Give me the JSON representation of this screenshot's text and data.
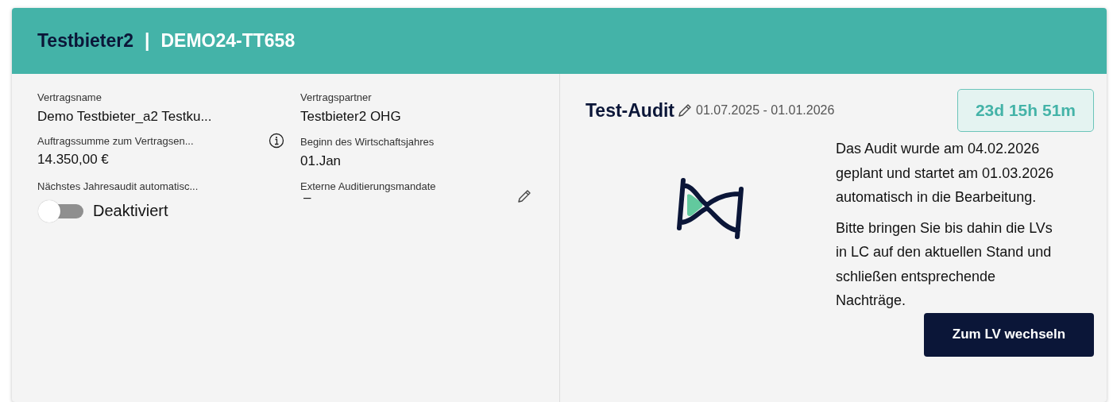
{
  "header": {
    "bidder": "Testbieter2",
    "separator": "|",
    "project_code": "DEMO24-TT658"
  },
  "contract_fields": [
    {
      "label": "Vertragsname",
      "value": "Demo Testbieter_a2 Testku...",
      "kind": "text"
    },
    {
      "label": "Vertragspartner",
      "value": "Testbieter2 OHG",
      "kind": "text"
    },
    {
      "label": "Auftragssumme zum Vertragsen...",
      "value": "14.350,00 €",
      "kind": "info"
    },
    {
      "label": "Beginn des Wirtschaftsjahres",
      "value": "01.Jan",
      "kind": "text"
    },
    {
      "label": "Nächstes Jahresaudit automatisc...",
      "value": "Deaktiviert",
      "kind": "toggle",
      "on": false
    },
    {
      "label": "Externe Auditierungsmandate",
      "value": "–",
      "kind": "editable"
    }
  ],
  "audit": {
    "title": "Test-Audit",
    "period": "01.07.2025 - 01.01.2026",
    "countdown": "23d 15h 51m",
    "paragraphs": [
      "Das Audit wurde am 04.02.2026 geplant und startet am 01.03.2026 automatisch in die Bearbeitung.",
      "Bitte bringen Sie bis dahin die LVs in LC auf den aktuellen Stand und schließen entsprechende Nachträge."
    ],
    "button": "Zum LV wechseln"
  }
}
